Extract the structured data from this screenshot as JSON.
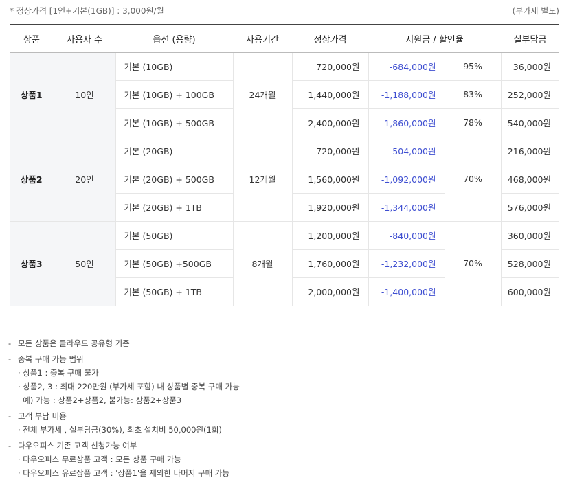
{
  "header": {
    "note_left": "* 정상가격 [1인+기본(1GB)] : 3,000원/월",
    "note_right": "(부가세 별도)"
  },
  "columns": [
    "상품",
    "사용자 수",
    "옵션 (용량)",
    "사용기간",
    "정상가격",
    "지원금 / 할인율",
    "실부담금"
  ],
  "groups": [
    {
      "name": "상품1",
      "users": "10인",
      "period": "24개월",
      "rate_merged": false,
      "rows": [
        {
          "option": "기본 (10GB)",
          "regular": "720,000원",
          "support": "-684,000원",
          "rate": "95%",
          "actual": "36,000원"
        },
        {
          "option": "기본 (10GB) + 100GB",
          "regular": "1,440,000원",
          "support": "-1,188,000원",
          "rate": "83%",
          "actual": "252,000원"
        },
        {
          "option": "기본 (10GB) + 500GB",
          "regular": "2,400,000원",
          "support": "-1,860,000원",
          "rate": "78%",
          "actual": "540,000원"
        }
      ]
    },
    {
      "name": "상품2",
      "users": "20인",
      "period": "12개월",
      "rate_merged": true,
      "rate": "70%",
      "rows": [
        {
          "option": "기본 (20GB)",
          "regular": "720,000원",
          "support": "-504,000원",
          "actual": "216,000원"
        },
        {
          "option": "기본 (20GB) + 500GB",
          "regular": "1,560,000원",
          "support": "-1,092,000원",
          "actual": "468,000원"
        },
        {
          "option": "기본 (20GB) + 1TB",
          "regular": "1,920,000원",
          "support": "-1,344,000원",
          "actual": "576,000원"
        }
      ]
    },
    {
      "name": "상품3",
      "users": "50인",
      "period": "8개월",
      "rate_merged": true,
      "rate": "70%",
      "rows": [
        {
          "option": "기본 (50GB)",
          "regular": "1,200,000원",
          "support": "-840,000원",
          "actual": "360,000원"
        },
        {
          "option": "기본 (50GB) +500GB",
          "regular": "1,760,000원",
          "support": "-1,232,000원",
          "actual": "528,000원"
        },
        {
          "option": "기본 (50GB) + 1TB",
          "regular": "2,000,000원",
          "support": "-1,400,000원",
          "actual": "600,000원"
        }
      ]
    }
  ],
  "notes": [
    {
      "title": "모든 상품은 클라우드 공유형 기준",
      "subs": []
    },
    {
      "title": "중복 구매 가능 범위",
      "subs": [
        "· 상품1 : 중복 구매 불가",
        "· 상품2, 3 : 최대 220만원 (부가세 포함) 내 상품별 중복 구매 가능",
        "  예) 가능 : 상품2+상품2, 불가능: 상품2+상품3"
      ]
    },
    {
      "title": "고객 부담 비용",
      "subs": [
        "· 전체 부가세 , 실부담금(30%), 최초 설치비 50,000원(1회)"
      ]
    },
    {
      "title": "다우오피스 기존 고객 신청가능 여부",
      "subs": [
        "· 다우오피스 무료상품 고객 : 모든 상품 구매 가능",
        "· 다우오피스 유료상품 고객 : '상품1'을 제외한 나머지 구매 가능"
      ]
    }
  ]
}
